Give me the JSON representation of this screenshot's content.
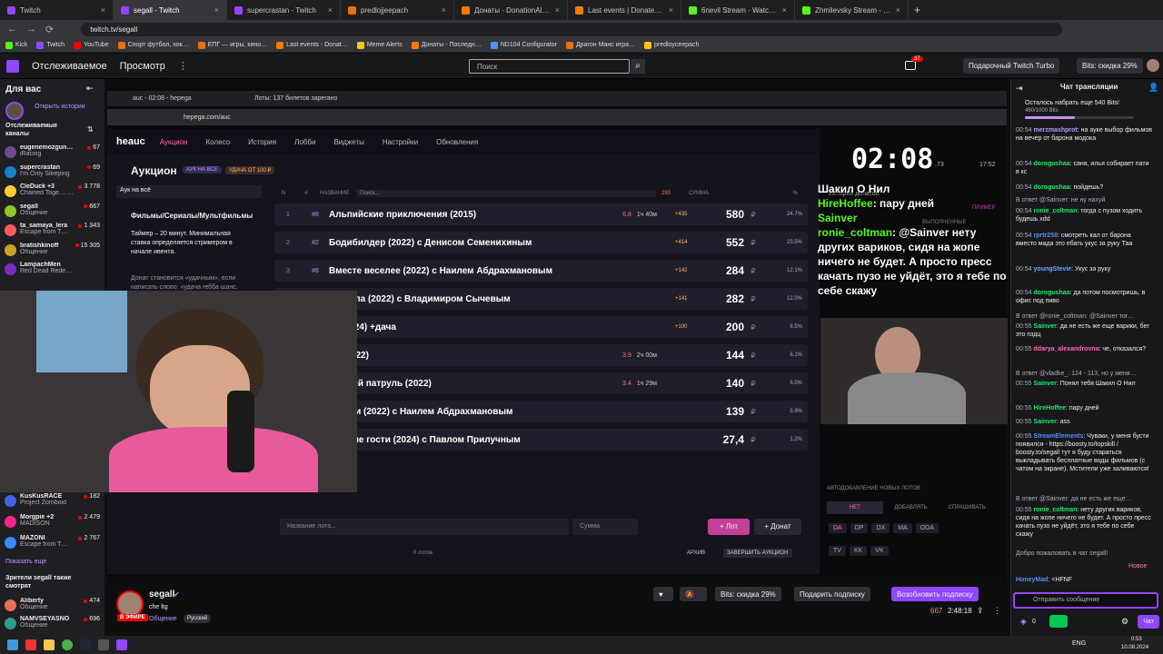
{
  "browser": {
    "tabs": [
      {
        "label": "Twitch",
        "color": "#9147ff"
      },
      {
        "label": "segall - Twitch",
        "color": "#9147ff",
        "active": true
      },
      {
        "label": "supercrastan - Twitch",
        "color": "#9147ff"
      },
      {
        "label": "predlojjeepach",
        "color": "#e8710a"
      },
      {
        "label": "Донаты - DonationAlerts",
        "color": "#f57c00"
      },
      {
        "label": "Last events | DonatePay",
        "color": "#f57c00"
      },
      {
        "label": "6nevil Stream - Watch Live on",
        "color": "#53fc18"
      },
      {
        "label": "Zhmilevsky Stream - Watch Liv",
        "color": "#53fc18"
      }
    ],
    "url": "twitch.tv/segall",
    "bookmarks": [
      "Kick",
      "Twitch",
      "YouTube",
      "Спорт футбол, хок…",
      "ЕПГ — игры, кино…",
      "Last events - Donat…",
      "Meme Alerts",
      "Донаты - Последн…",
      "ND104 Configurator",
      "Драгон Манс игра…",
      "predloyceepach"
    ]
  },
  "twitch": {
    "nav_following": "Отслеживаемое",
    "nav_browse": "Просмотр",
    "search_placeholder": "Поиск",
    "notif_count": "37",
    "turbo_label": "Подарочный Twitch Turbo",
    "bits_label": "Bits: скидка 29%"
  },
  "sidebar": {
    "title": "Для вас",
    "history": "Открыть истории",
    "following_header": "Отслеживаемые каналы",
    "channels": [
      {
        "name": "eugenemozgun…",
        "game": "iRacing",
        "viewers": "67",
        "color": "#6a4c93"
      },
      {
        "name": "supercrastan",
        "game": "I'm Only Sleeping",
        "viewers": "69",
        "color": "#1982c4"
      },
      {
        "name": "CleDuck +3",
        "game": "Chained Toge… Мегахайповые, уно…",
        "viewers": "3 778",
        "color": "#ffca3a"
      },
      {
        "name": "segall",
        "game": "Общение",
        "viewers": "667",
        "color": "#8ac926"
      },
      {
        "name": "ta_samaya_lera",
        "game": "Escape from T…",
        "viewers": "1 343",
        "color": "#ff595e"
      },
      {
        "name": "bratishkinoff",
        "game": "Общение",
        "viewers": "15 305",
        "color": "#c9a227"
      },
      {
        "name": "LampachMen",
        "game": "Red Dead Rede…",
        "viewers": "",
        "color": "#7b2cbf"
      }
    ],
    "channels_lower": [
      {
        "name": "KusKusRACE",
        "game": "Project Zomboid",
        "viewers": "182",
        "color": "#4361ee"
      },
      {
        "name": "Morgpie +2",
        "game": "MADISON",
        "viewers": "2 479",
        "color": "#f72585"
      },
      {
        "name": "MAZONI",
        "game": "Escape from T…",
        "viewers": "2 767",
        "color": "#3a86ff"
      }
    ],
    "show_more": "Показать еще",
    "also_watch": "Зрители segall также смотрят",
    "also_channels": [
      {
        "name": "AIiberty",
        "game": "Общение",
        "viewers": "474",
        "color": "#e76f51"
      },
      {
        "name": "NAMVSEYASNO",
        "game": "Общение",
        "viewers": "696",
        "color": "#2a9d8f"
      }
    ]
  },
  "inner_browser": {
    "tab1": "аuc - 02:08 - hepega",
    "tab2": "Лоты: 137 билетов зарегано",
    "url": "hepega.com/auc"
  },
  "auction": {
    "logo": "heauc",
    "nav": [
      "Аукцион",
      "Колесо",
      "История",
      "Лобби",
      "Виджеты",
      "Настройки",
      "Обновления"
    ],
    "title": "Аукцион",
    "badge1": "АУК НА ВСЕ",
    "badge2": "УДАЧА ОТ 100 ₽",
    "category": "Фильмы/Сериалы/Мультфильмы",
    "auc_for_all": "Аук на всё",
    "timer_note": "Таймер – 20 минут. Минимальная ставка определяется стримером в начале ивента.",
    "donate_note": "Донат становится «удачным», если написать слово: «удача гебба шанс.",
    "columns": {
      "n": "N",
      "hash": "#",
      "name": "НАЗВАНИЕ",
      "search": "Поиск...",
      "count": "293",
      "sum": "СУММА",
      "pct": "%"
    },
    "lots": [
      {
        "n": "1",
        "tag": "#8",
        "name": "Альпийские приключения (2015)",
        "rating": "6.8",
        "dur": "1ч 40м",
        "bonus": "+435",
        "amount": "580",
        "pct": "24.7%"
      },
      {
        "n": "2",
        "tag": "#2",
        "name": "Бодибилдер (2022) с Денисом Семенихиным",
        "rating": "",
        "dur": "",
        "bonus": "+414",
        "amount": "552",
        "pct": "23.5%"
      },
      {
        "n": "3",
        "tag": "#6",
        "name": "Вместе веселее (2022) с Наилем Абдрахмановым",
        "rating": "",
        "dur": "",
        "bonus": "+142",
        "amount": "284",
        "pct": "12.1%"
      },
      {
        "n": "4",
        "tag": "",
        "name": "сначала (2022) с Владимиром Сычевым",
        "rating": "",
        "dur": "",
        "bonus": "+141",
        "amount": "282",
        "pct": "12.0%"
      },
      {
        "n": "5",
        "tag": "",
        "name": "ка (2024) +дача",
        "rating": "",
        "dur": "",
        "bonus": "+100",
        "amount": "200",
        "pct": "8.5%"
      },
      {
        "n": "6",
        "tag": "",
        "name": "on (2022)",
        "rating": "3.9",
        "dur": "2ч 00м",
        "bonus": "",
        "amount": "144",
        "pct": "6.1%"
      },
      {
        "n": "7",
        "tag": "",
        "name": "хматый патруль (2022)",
        "rating": "3.4",
        "dur": "1ч 29м",
        "bonus": "",
        "amount": "140",
        "pct": "6.0%"
      },
      {
        "n": "8",
        "tag": "",
        "name": "предки (2022) с Наилем Абдрахмановым",
        "rating": "",
        "dur": "",
        "bonus": "",
        "amount": "139",
        "pct": "5.9%"
      },
      {
        "n": "9",
        "tag": "",
        "name": "личные гости (2024) с Павлом Прилучным",
        "rating": "",
        "dur": "",
        "bonus": "",
        "amount": "27,4",
        "pct": "1.2%"
      }
    ],
    "currency": "₽",
    "lot_name_placeholder": "Название лота...",
    "sum_placeholder": "Сумма",
    "add_lot": "+ Лот",
    "add_donate": "+ Донат",
    "lots_count": "0 лотов",
    "archive": "АРХИВ",
    "finish": "ЗАВЕРШИТЬ АУКЦИОН",
    "auto_add": "АВТОДОБАВЛЕНИЕ НОВЫХ ЛОТОВ",
    "auto_opts": [
      "НЕТ",
      "ДОБАВЛЯТЬ",
      "СПРАШИВАТЬ"
    ],
    "providers": [
      "DA",
      "DP",
      "DX",
      "MA",
      "ODA"
    ],
    "providers2": [
      "TV",
      "KK",
      "VK"
    ],
    "timer": "02:08",
    "timer_small": ".73",
    "timer_clock": "17:52",
    "donate_history": "История донатов",
    "new_label": "Новые",
    "accept_label": "ПРИМЕР",
    "done_label": "ВЫПОЛНЕННЫЕ"
  },
  "overlay_chat": [
    {
      "user": "",
      "text": "Шакил О Нил"
    },
    {
      "user": "HireHoffee",
      "text": ": пару дней"
    },
    {
      "user": "Sainver",
      "text": ""
    },
    {
      "user": "ronie_coltman",
      "text": ": @Sainver нету других вариков, сидя на жопе ничего не будет. А просто пресс качать пузо не уйдёт, это я тебе по себе скажу"
    }
  ],
  "stream_info": {
    "channel": "segall",
    "title": "che ltg",
    "category": "Общение",
    "tag": "Русский",
    "live": "В ЭФИРЕ",
    "bits_discount": "Bits: скидка 29%",
    "gift_sub": "Подарить подписку",
    "resub": "Возобновить подписку",
    "viewers": "667",
    "uptime": "2:48:18"
  },
  "chat": {
    "title": "Чат трансляции",
    "bits_goal": "Осталось набрать еще 540 Bits!",
    "bits_progress": "460/1000 Bits",
    "bits_progress_fraction": 0.46,
    "messages": [
      {
        "time": "00:54",
        "user": "merzmashprot",
        "color": "#b19cff",
        "text": "на ауке выбор фильмов на вечер от барона модока"
      },
      {
        "time": "00:54",
        "user": "dorogushaa",
        "color": "#1ee86f",
        "text": "саня, илья собирает пати в кс"
      },
      {
        "time": "00:54",
        "user": "dorogushaa",
        "color": "#1ee86f",
        "text": "пойдешь?"
      },
      {
        "time": "",
        "user": "",
        "color": "#adadb8",
        "text": "В ответ @Sainver: не нy нахуй"
      },
      {
        "time": "00:54",
        "user": "ronie_coltman",
        "color": "#1ee86f",
        "text": "тогда с пузом ходить будешь xdd"
      },
      {
        "time": "00:54",
        "user": "rprtr258",
        "color": "#5a8cff",
        "text": "смотреть кал от барона вместо мада это ебать укус за руку Таа"
      },
      {
        "time": "00:54",
        "user": "youngStevie",
        "color": "#6fa8ff",
        "text": "Укус за руку"
      },
      {
        "time": "00:54",
        "user": "dorogushaa",
        "color": "#1ee86f",
        "text": "да потом посмотришь, в офис под пиво"
      },
      {
        "time": "",
        "user": "",
        "color": "#adadb8",
        "text": "В ответ @ronie_coltman: @Sainver тог…"
      },
      {
        "time": "00:55",
        "user": "Sainver",
        "color": "#1ee86f",
        "text": "да не есть же еще варики, бег это пздц"
      },
      {
        "time": "00:55",
        "user": "ddarya_alexandrovna",
        "color": "#ff69b4",
        "text": "че, отказался?"
      },
      {
        "time": "",
        "user": "",
        "color": "#adadb8",
        "text": "В ответ @vladke_: 124 - 113, но у меня…"
      },
      {
        "time": "00:55",
        "user": "Sainver",
        "color": "#1ee86f",
        "text": "Понял тебя Шакил О Нил"
      },
      {
        "time": "00:55",
        "user": "HireHoffee",
        "color": "#1ee86f",
        "text": "пару дней"
      },
      {
        "time": "00:55",
        "user": "Sainver",
        "color": "#1ee86f",
        "text": "ass"
      },
      {
        "time": "00:55",
        "user": "StreamElements",
        "color": "#5a8cff",
        "text": "Чуваки, у меня бусти появился - https://boosty.to/topskill / boosty.to/segall тут я буду стараться выкладывать бесплатные воды фильмов (с чатом на экране). Мстители уже заливаются!"
      },
      {
        "time": "",
        "user": "",
        "color": "#adadb8",
        "text": "В ответ @Sainver: да не есть же еще…"
      },
      {
        "time": "00:55",
        "user": "ronie_coltman",
        "color": "#1ee86f",
        "text": "нету других вариков, сидя на жопе ничего не будет. А просто пресс качать пузо не уйдёт, это я тебе по себе скажу"
      },
      {
        "time": "",
        "user": "",
        "color": "#adadb8",
        "text": "Добро пожаловать в чат segall!"
      }
    ],
    "new_label": "Новое",
    "last_user": "HoneyMad",
    "last_text": "<HFNF",
    "placeholder": "Отправить сообщение",
    "points": "0",
    "send": "Чат"
  },
  "taskbar": {
    "lang": "ENG",
    "time": "0:53",
    "date": "10.08.2024"
  }
}
